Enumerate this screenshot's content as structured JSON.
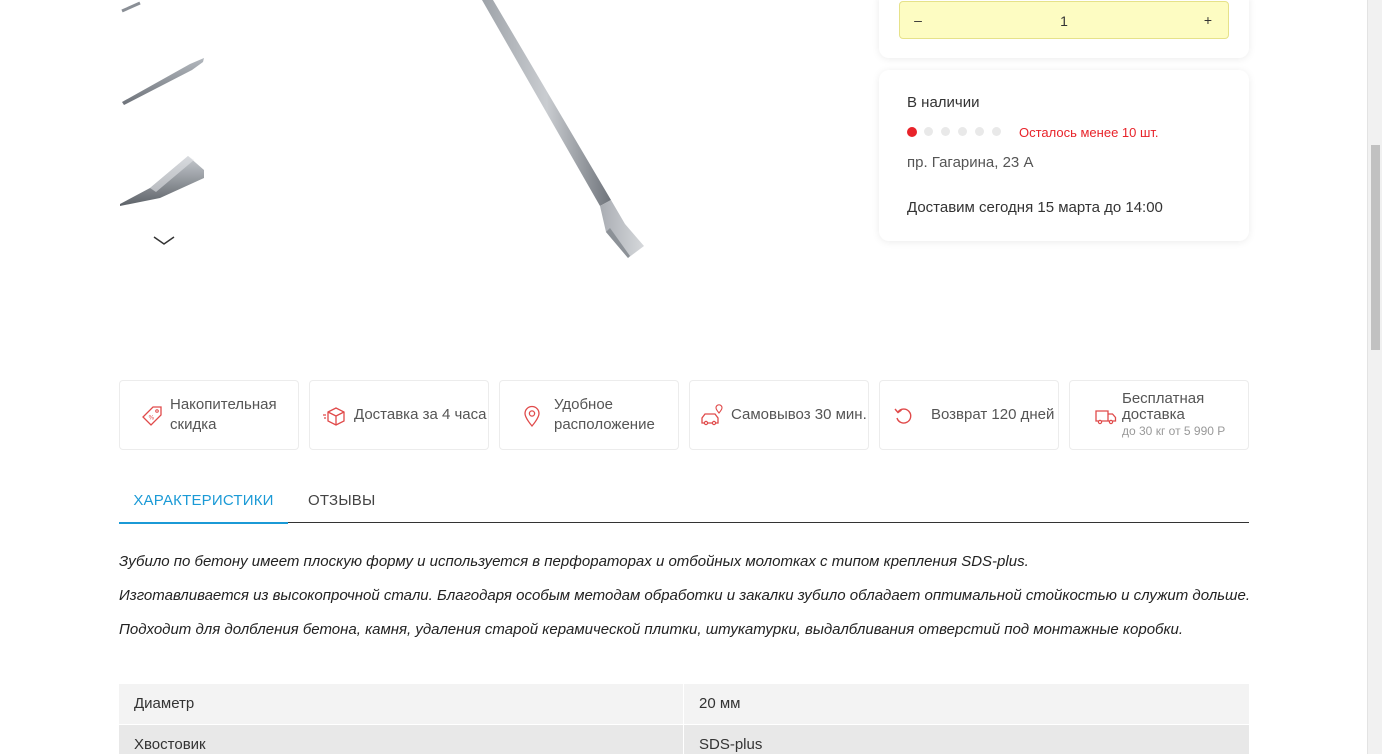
{
  "colors": {
    "accent_blue": "#1b9ad6",
    "stock_red": "#e8232a",
    "qty_bg": "#fdfcc2",
    "feature_icon_red": "#e04a4a"
  },
  "gallery": {
    "thumbnails": [
      {
        "icon": "chisel-tip-thumbnail"
      },
      {
        "icon": "chisel-side-thumbnail"
      },
      {
        "icon": "chisel-closeup-thumbnail"
      }
    ],
    "next_icon": "chevron-down-icon"
  },
  "quantity": {
    "minus_label": "–",
    "value": "1",
    "plus_label": "+"
  },
  "stock": {
    "title": "В наличии",
    "level_dots_total": 6,
    "level_dots_filled": 1,
    "remaining_text": "Осталось менее 10 шт.",
    "address": "пр. Гагарина, 23 А",
    "delivery": "Доставим сегодня 15 марта до 14:00"
  },
  "features": [
    {
      "icon": "discount-tag-icon",
      "label": "Накопительная скидка"
    },
    {
      "icon": "box-delivery-icon",
      "label": "Доставка за 4 часа"
    },
    {
      "icon": "location-pin-icon",
      "label": "Удобное расположение"
    },
    {
      "icon": "car-pickup-icon",
      "label": "Самовывоз 30 мин."
    },
    {
      "icon": "return-arrow-icon",
      "label": "Возврат 120 дней"
    },
    {
      "icon": "free-truck-icon",
      "label": "Бесплатная доставка",
      "sublabel": "до 30 кг от 5 990 Р"
    }
  ],
  "tabs": [
    {
      "label": "ХАРАКТЕРИСТИКИ",
      "active": true
    },
    {
      "label": "ОТЗЫВЫ",
      "active": false
    }
  ],
  "description": [
    "Зубило по бетону имеет плоскую форму и используется в перфораторах и отбойных молотках с типом крепления SDS-plus.",
    "Изготавливается из высокопрочной стали. Благодаря особым методам обработки и закалки зубило обладает оптимальной стойкостью и служит дольше.",
    "Подходит для долбления бетона, камня, удаления старой керамической плитки, штукатурки, выдалбливания отверстий под монтажные коробки."
  ],
  "specs": [
    {
      "key": "Диаметр",
      "value": "20 мм"
    },
    {
      "key": "Хвостовик",
      "value": "SDS-plus"
    }
  ]
}
